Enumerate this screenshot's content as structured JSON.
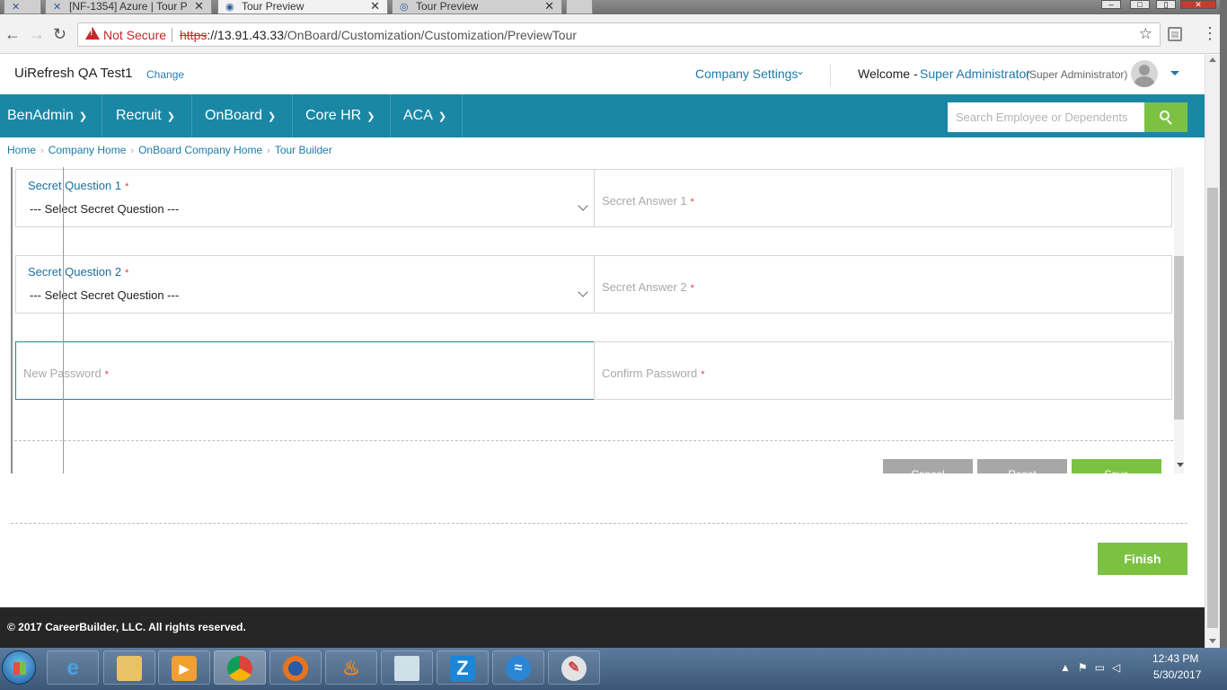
{
  "browser": {
    "tabs": [
      {
        "title": "",
        "icon": "app-logo-icon"
      },
      {
        "title": "[NF-1354] Azure | Tour P",
        "icon": "app-logo-icon"
      },
      {
        "title": "Tour Preview",
        "icon": "page-icon",
        "active": true
      },
      {
        "title": "Tour Preview",
        "icon": "page-icon"
      }
    ],
    "security_label": "Not Secure",
    "url_scheme": "https",
    "url_host": "://13.91.43.33",
    "url_path": "/OnBoard/Customization/Customization/PreviewTour"
  },
  "header": {
    "client_name": "UiRefresh QA Test1",
    "change_label": "Change",
    "company_settings": "Company Settings",
    "welcome": "Welcome -",
    "user_name": "Super Administrator",
    "user_role": "(Super Administrator)"
  },
  "nav": {
    "items": [
      "BenAdmin",
      "Recruit",
      "OnBoard",
      "Core HR",
      "ACA"
    ],
    "search_placeholder": "Search Employee or Dependents"
  },
  "breadcrumb": [
    "Home",
    "Company Home",
    "OnBoard Company Home",
    "Tour Builder"
  ],
  "form": {
    "secret_question_1_label": "Secret Question 1",
    "secret_question_2_label": "Secret Question 2",
    "select_placeholder": "--- Select Secret Question ---",
    "secret_answer_1_label": "Secret Answer 1",
    "secret_answer_2_label": "Secret Answer 2",
    "new_password_label": "New Password",
    "confirm_password_label": "Confirm Password",
    "required_mark": "*"
  },
  "tour_buttons": [
    "Cancel",
    "Reset",
    "Save"
  ],
  "finish_label": "Finish",
  "footer_text": "© 2017 CareerBuilder, LLC. All rights reserved.",
  "taskbar": {
    "time": "12:43 PM",
    "date": "5/30/2017"
  },
  "colors": {
    "nav_bar": "#1a87a5",
    "accent_green": "#7cc242",
    "link_blue": "#1e7aa8",
    "required_red": "#e53935",
    "footer": "#262626"
  }
}
